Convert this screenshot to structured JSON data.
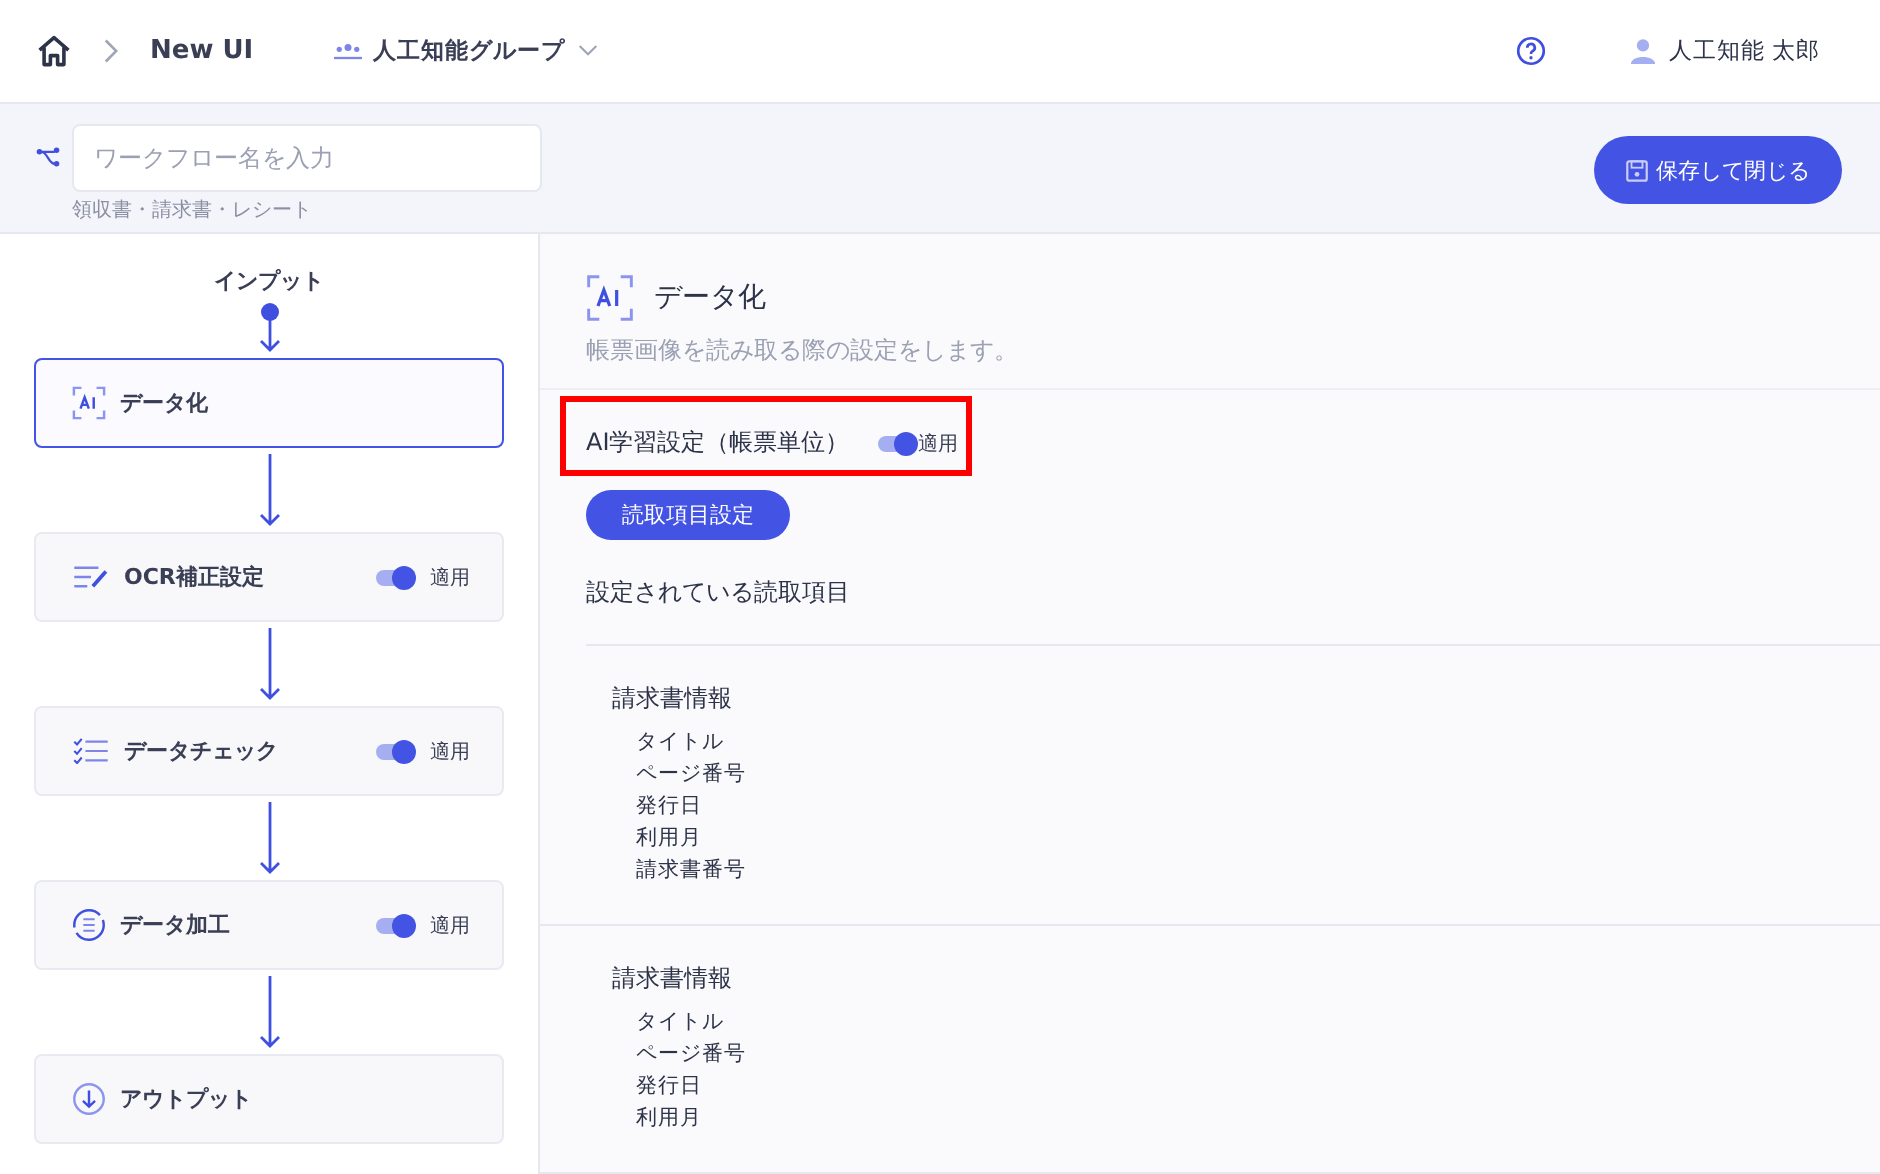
{
  "header": {
    "breadcrumb": "New UI",
    "group": "人工知能グループ",
    "user": "人工知能 太郎"
  },
  "workflow": {
    "placeholder": "ワークフロー名を入力",
    "hint": "領収書・請求書・レシート",
    "save_button": "保存して閉じる"
  },
  "flow": {
    "input_label": "インプット",
    "steps": [
      {
        "kind": "ai",
        "label": "データ化",
        "selected": true
      },
      {
        "kind": "ocr",
        "label": "OCR補正設定",
        "selected": false,
        "toggle": {
          "on": true,
          "label": "適用"
        }
      },
      {
        "kind": "check",
        "label": "データチェック",
        "selected": false,
        "toggle": {
          "on": true,
          "label": "適用"
        }
      },
      {
        "kind": "process",
        "label": "データ加工",
        "selected": false,
        "toggle": {
          "on": true,
          "label": "適用"
        }
      },
      {
        "kind": "output",
        "label": "アウトプット",
        "selected": false
      }
    ]
  },
  "detail": {
    "title": "データ化",
    "description": "帳票画像を読み取る際の設定をします。",
    "ai_learning": {
      "label": "AI学習設定（帳票単位）",
      "on": true,
      "toggle_label": "適用"
    },
    "button": "読取項目設定",
    "section_title": "設定されている読取項目",
    "groups": [
      {
        "title": "請求書情報",
        "items": [
          "タイトル",
          "ページ番号",
          "発行日",
          "利用月",
          "請求書番号"
        ]
      },
      {
        "title": "請求書情報",
        "items": [
          "タイトル",
          "ページ番号",
          "発行日",
          "利用月"
        ]
      }
    ]
  }
}
